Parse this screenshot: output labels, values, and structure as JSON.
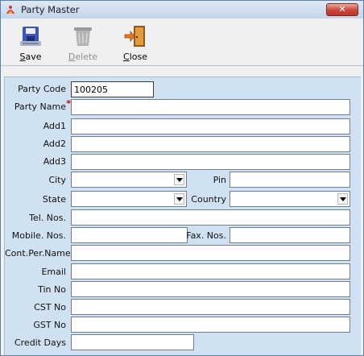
{
  "window": {
    "title": "Party Master",
    "close_label": "✕"
  },
  "toolbar": {
    "save": {
      "label": "Save",
      "mnemonic": "S",
      "rest": "ave"
    },
    "delete": {
      "label": "Delete",
      "mnemonic": "D",
      "rest": "elete"
    },
    "close": {
      "label": "Close",
      "mnemonic": "C",
      "rest": "lose"
    }
  },
  "form": {
    "party_code": {
      "label": "Party Code",
      "value": "100205"
    },
    "party_name": {
      "label": "Party Name",
      "required_marker": "*",
      "value": ""
    },
    "add1": {
      "label": "Add1",
      "value": ""
    },
    "add2": {
      "label": "Add2",
      "value": ""
    },
    "add3": {
      "label": "Add3",
      "value": ""
    },
    "city": {
      "label": "City",
      "value": ""
    },
    "pin": {
      "label": "Pin",
      "value": ""
    },
    "state": {
      "label": "State",
      "value": ""
    },
    "country": {
      "label": "Country",
      "value": ""
    },
    "tel": {
      "label": "Tel. Nos.",
      "value": ""
    },
    "mobile": {
      "label": "Mobile. Nos.",
      "value": ""
    },
    "fax": {
      "label": "Fax. Nos.",
      "value": ""
    },
    "contact": {
      "label": "Cont.Per.Name",
      "value": ""
    },
    "email": {
      "label": "Email",
      "value": ""
    },
    "tin": {
      "label": "Tin No",
      "value": ""
    },
    "cst": {
      "label": "CST No",
      "value": ""
    },
    "gst": {
      "label": "GST No",
      "value": ""
    },
    "credit_days": {
      "label": "Credit Days",
      "value": ""
    }
  },
  "colors": {
    "required": "#d00000",
    "panel": "#d0e1f2",
    "close_button": "#c9463a"
  },
  "icons": {
    "app": "app-logo-icon",
    "save": "floppy-disk-icon",
    "delete": "trash-bin-icon",
    "close": "exit-door-icon"
  }
}
